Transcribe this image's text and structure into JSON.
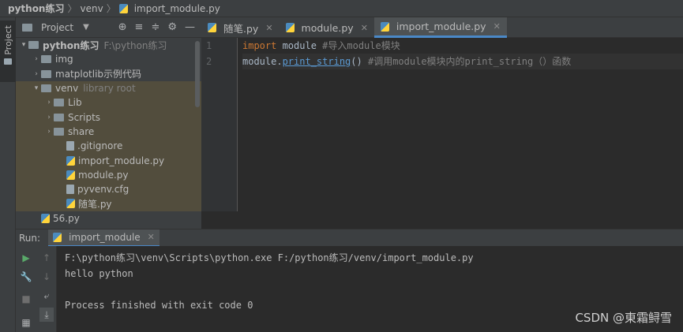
{
  "breadcrumb": {
    "root": "python练习",
    "folder": "venv",
    "file": "import_module.py"
  },
  "left_strip": {
    "project_tab": "Project"
  },
  "project": {
    "title": "Project",
    "tree": [
      {
        "label": "python练习",
        "hint": "F:\\python练习",
        "kind": "folder",
        "indent": 0,
        "arrow": "▾",
        "bold": true
      },
      {
        "label": "img",
        "hint": "",
        "kind": "folder",
        "indent": 1,
        "arrow": "›"
      },
      {
        "label": "matplotlib示例代码",
        "hint": "",
        "kind": "folder",
        "indent": 1,
        "arrow": "›"
      },
      {
        "label": "venv",
        "hint": "library root",
        "kind": "folder",
        "indent": 1,
        "arrow": "▾"
      },
      {
        "label": "Lib",
        "hint": "",
        "kind": "folder",
        "indent": 2,
        "arrow": "›"
      },
      {
        "label": "Scripts",
        "hint": "",
        "kind": "folder",
        "indent": 2,
        "arrow": "›"
      },
      {
        "label": "share",
        "hint": "",
        "kind": "folder",
        "indent": 2,
        "arrow": "›"
      },
      {
        "label": ".gitignore",
        "hint": "",
        "kind": "txt",
        "indent": 3,
        "arrow": ""
      },
      {
        "label": "import_module.py",
        "hint": "",
        "kind": "py",
        "indent": 3,
        "arrow": ""
      },
      {
        "label": "module.py",
        "hint": "",
        "kind": "py",
        "indent": 3,
        "arrow": ""
      },
      {
        "label": "pyvenv.cfg",
        "hint": "",
        "kind": "txt",
        "indent": 3,
        "arrow": ""
      },
      {
        "label": "随笔.py",
        "hint": "",
        "kind": "py",
        "indent": 3,
        "arrow": ""
      },
      {
        "label": "56.py",
        "hint": "",
        "kind": "py",
        "indent": 1,
        "arrow": ""
      }
    ]
  },
  "tabs": [
    {
      "label": "随笔.py",
      "active": false
    },
    {
      "label": "module.py",
      "active": false
    },
    {
      "label": "import_module.py",
      "active": true
    }
  ],
  "editor": {
    "line_numbers": [
      "1",
      "2"
    ],
    "line1": {
      "kw": "import",
      "rest": " module ",
      "comment": "#导入module模块"
    },
    "line2": {
      "pre": "module.",
      "fn": "print_string",
      "post": "() ",
      "comment": "#调用module模块内的print_string（）函数"
    }
  },
  "run": {
    "label": "Run:",
    "tab": "import_module",
    "console": [
      "F:\\python练习\\venv\\Scripts\\python.exe F:/python练习/venv/import_module.py",
      "hello python",
      "",
      "Process finished with exit code 0"
    ]
  },
  "watermark": "CSDN @東霜鲟雪",
  "colors": {
    "accent": "#4a88c7",
    "keyword": "#cc7832",
    "comment": "#808080",
    "highlight": "#524d3d"
  }
}
